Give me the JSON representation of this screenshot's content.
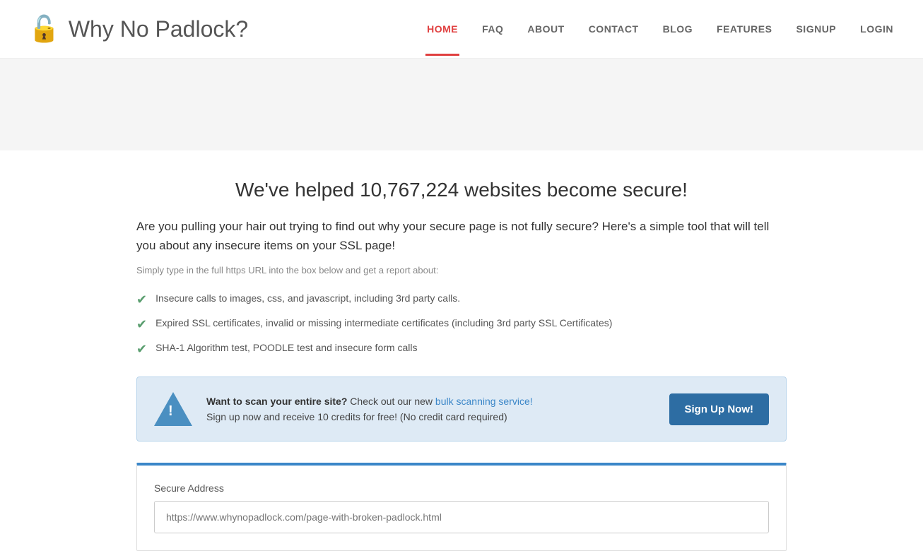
{
  "header": {
    "logo_text": "Why No Padlock?",
    "nav_items": [
      {
        "label": "HOME",
        "id": "home",
        "active": true
      },
      {
        "label": "FAQ",
        "id": "faq",
        "active": false
      },
      {
        "label": "ABOUT",
        "id": "about",
        "active": false
      },
      {
        "label": "CONTACT",
        "id": "contact",
        "active": false
      },
      {
        "label": "BLOG",
        "id": "blog",
        "active": false
      },
      {
        "label": "FEATURES",
        "id": "features",
        "active": false
      },
      {
        "label": "SIGNUP",
        "id": "signup",
        "active": false
      },
      {
        "label": "LOGIN",
        "id": "login",
        "active": false
      }
    ]
  },
  "main": {
    "headline": "We've helped 10,767,224 websites become secure!",
    "description": "Are you pulling your hair out trying to find out why your secure page is not fully secure? Here's a simple tool that will tell you about any insecure items on your SSL page!",
    "subtitle": "Simply type in the full https URL into the box below and get a report about:",
    "features": [
      "Insecure calls to images, css, and javascript, including 3rd party calls.",
      "Expired SSL certificates, invalid or missing intermediate certificates (including 3rd party SSL Certificates)",
      "SHA-1 Algorithm test, POODLE test and insecure form calls"
    ],
    "banner": {
      "bold_text": "Want to scan your entire site?",
      "link_text": "bulk scanning service!",
      "description": "Check out our new bulk scanning service!",
      "subtext": "Sign up now and receive 10 credits for free! (No credit card required)",
      "button_label": "Sign Up Now!"
    },
    "form": {
      "label": "Secure Address",
      "placeholder": "https://www.whynopadlock.com/page-with-broken-padlock.html"
    }
  }
}
